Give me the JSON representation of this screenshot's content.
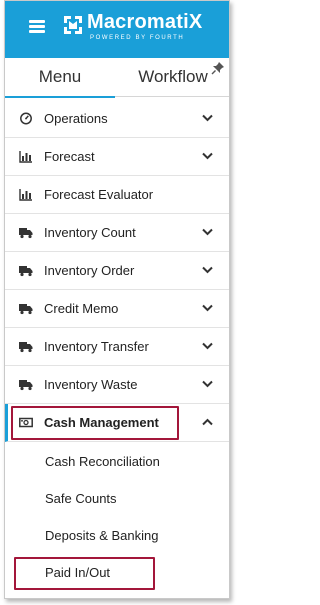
{
  "brand": {
    "name": "MacromatiX",
    "tagline": "POWERED BY FOURTH",
    "header_color": "#1a9fd8"
  },
  "tabs": {
    "menu_label": "Menu",
    "workflow_label": "Workflow",
    "active": "Menu"
  },
  "menu": {
    "items": [
      {
        "label": "Operations",
        "icon": "speedometer-icon",
        "expandable": true
      },
      {
        "label": "Forecast",
        "icon": "bar-chart-icon",
        "expandable": true
      },
      {
        "label": "Forecast Evaluator",
        "icon": "bar-chart-icon",
        "expandable": false
      },
      {
        "label": "Inventory Count",
        "icon": "truck-icon",
        "expandable": true
      },
      {
        "label": "Inventory Order",
        "icon": "truck-icon",
        "expandable": true
      },
      {
        "label": "Credit Memo",
        "icon": "truck-icon",
        "expandable": true
      },
      {
        "label": "Inventory Transfer",
        "icon": "truck-icon",
        "expandable": true
      },
      {
        "label": "Inventory Waste",
        "icon": "truck-icon",
        "expandable": true
      },
      {
        "label": "Cash Management",
        "icon": "cash-icon",
        "expandable": true,
        "expanded": true
      }
    ],
    "cash_management_subitems": [
      {
        "label": "Cash Reconciliation"
      },
      {
        "label": "Safe Counts"
      },
      {
        "label": "Deposits & Banking"
      },
      {
        "label": "Paid In/Out"
      }
    ]
  },
  "highlight_color": "#a3163a"
}
